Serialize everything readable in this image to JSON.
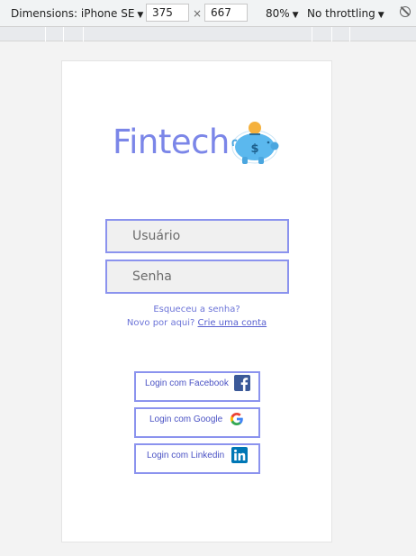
{
  "devtools": {
    "dimensions_label": "Dimensions: iPhone SE",
    "width": "375",
    "height": "667",
    "separator": "×",
    "zoom": "80%",
    "throttling": "No throttling"
  },
  "brand": {
    "title": "Fintech",
    "logo_icon": "piggy-bank-icon"
  },
  "form": {
    "username_placeholder": "Usuário",
    "password_placeholder": "Senha"
  },
  "links": {
    "forgot_password": "Esqueceu a senha?",
    "new_here": "Novo por aqui?",
    "create_account": "Crie uma conta"
  },
  "social": {
    "facebook": "Login com Facebook",
    "google": "Login com Google",
    "linkedin": "Login com Linkedin"
  },
  "colors": {
    "accent": "#7b86e8",
    "field_border": "#8b93ee",
    "facebook": "#3b5998",
    "linkedin": "#0077b5"
  }
}
